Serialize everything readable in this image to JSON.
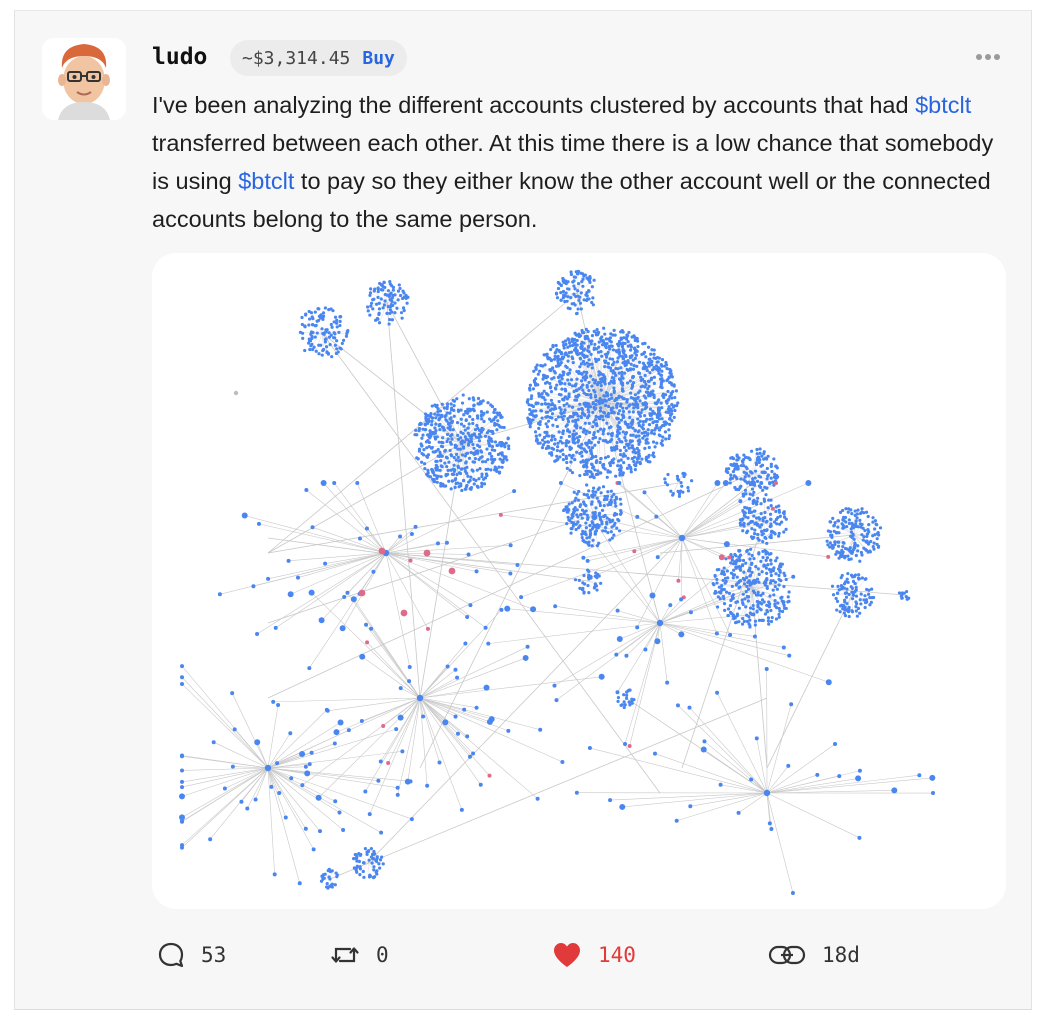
{
  "post": {
    "username": "ludo",
    "price": "~$3,314.45",
    "buy_label": "Buy",
    "text_parts": [
      {
        "type": "text",
        "value": "I've been analyzing the different accounts clustered by accounts that had "
      },
      {
        "type": "cashtag",
        "value": "$btclt"
      },
      {
        "type": "text",
        "value": " transferred between each other. At this time there is a low chance that somebody is using "
      },
      {
        "type": "cashtag",
        "value": "$btclt"
      },
      {
        "type": "text",
        "value": " to pay so they either know the other account well or the connected accounts belong to the same person."
      }
    ],
    "icons": {
      "more": "more-horizontal-icon",
      "comment": "comment-bubble-icon",
      "repost": "repost-icon",
      "like": "heart-icon",
      "link": "link-icon"
    }
  },
  "stats": {
    "comments": "53",
    "reposts": "0",
    "likes": "140",
    "age": "18d"
  },
  "colors": {
    "accent": "#2866e0",
    "like": "#e03a3a",
    "node": "#4a86f0",
    "node_highlight": "#e06a8a",
    "edge": "#c8c8c8"
  }
}
